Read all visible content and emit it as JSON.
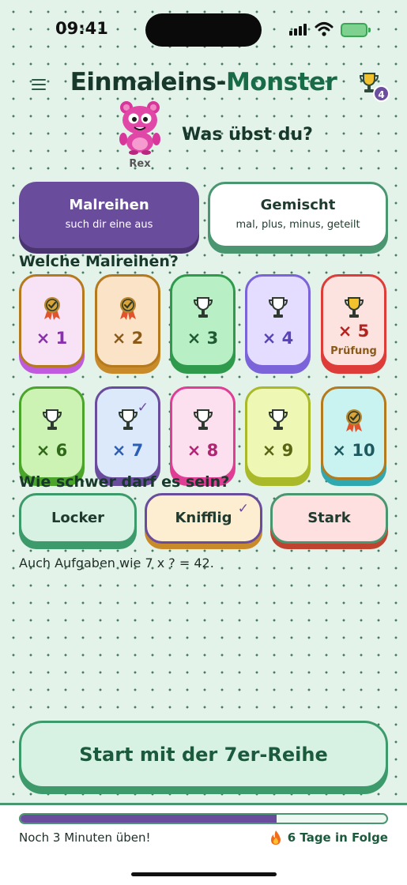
{
  "status": {
    "time": "09:41"
  },
  "header": {
    "title_part1": "Einmaleins-",
    "title_part2": "Monster",
    "trophy_count": "4"
  },
  "mascot": {
    "name": "Rex",
    "question": "Was übst du?"
  },
  "modes": [
    {
      "title": "Malreihen",
      "subtitle": "such dir eine aus",
      "selected": true
    },
    {
      "title": "Gemischt",
      "subtitle": "mal, plus, minus, geteilt",
      "selected": false
    }
  ],
  "tables_heading": "Welche Malreihen?",
  "tables": [
    {
      "label": "× 1",
      "icon": "medal-icon",
      "bg": "#f7e2f6",
      "border": "#b57a1d",
      "base": "#c05be0",
      "color": "#8a2fb0"
    },
    {
      "label": "× 2",
      "icon": "medal-icon",
      "bg": "#fbe3c8",
      "border": "#b57a1d",
      "base": "#c98a2a",
      "color": "#8b5a18"
    },
    {
      "label": "× 3",
      "icon": "trophy-icon",
      "bg": "#b9efc5",
      "border": "#2f9a4c",
      "base": "#2f9a4c",
      "color": "#1f5a33"
    },
    {
      "label": "× 4",
      "icon": "trophy-icon",
      "bg": "#e5ddff",
      "border": "#7b63d9",
      "base": "#7b63d9",
      "color": "#5a43b8"
    },
    {
      "label": "× 5",
      "icon": "gold-trophy-icon",
      "sub": "Prüfung",
      "bg": "#fde3df",
      "border": "#dd3c38",
      "base": "#dd3c38",
      "color": "#b3231f"
    },
    {
      "label": "× 6",
      "icon": "trophy-icon",
      "bg": "#cdf3b4",
      "border": "#4aa52a",
      "base": "#4aa52a",
      "color": "#2e6a18"
    },
    {
      "label": "× 7",
      "icon": "trophy-icon",
      "bg": "#dce9fb",
      "border": "#6a4c9c",
      "base": "#6a4c9c",
      "color": "#2a5fb5",
      "checked": true
    },
    {
      "label": "× 8",
      "icon": "trophy-icon",
      "bg": "#fde0ef",
      "border": "#e03d94",
      "base": "#e03d94",
      "color": "#b12473"
    },
    {
      "label": "× 9",
      "icon": "trophy-icon",
      "bg": "#eef8b4",
      "border": "#a9b92a",
      "base": "#a9b92a",
      "color": "#5a6514"
    },
    {
      "label": "× 10",
      "icon": "medal-icon",
      "bg": "#c8f3f1",
      "border": "#b57a1d",
      "base": "#30a8b0",
      "color": "#1f5a60"
    }
  ],
  "difficulty_heading": "Wie schwer darf es sein?",
  "difficulties": [
    {
      "label": "Locker",
      "bg": "#d7f1e3",
      "border": "#3d9a6b"
    },
    {
      "label": "Knifflig",
      "bg": "#fdeed2",
      "border": "#6a4c9c",
      "base": "#c98a2a",
      "selected": true
    },
    {
      "label": "Stark",
      "bg": "#fde0df",
      "border": "#4a9670",
      "base": "#c0432f"
    }
  ],
  "hint": "Auch Aufgaben wie 7 x ? = 42.",
  "start_label": "Start mit der 7er-Reihe",
  "footer": {
    "progress": 0.7,
    "left_text": "Noch 3 Minuten üben!",
    "streak_text": "6 Tage in Folge"
  },
  "colors": {
    "accent": "#6a4c9c",
    "green": "#3d9a6b",
    "background": "#e3f3ea"
  }
}
